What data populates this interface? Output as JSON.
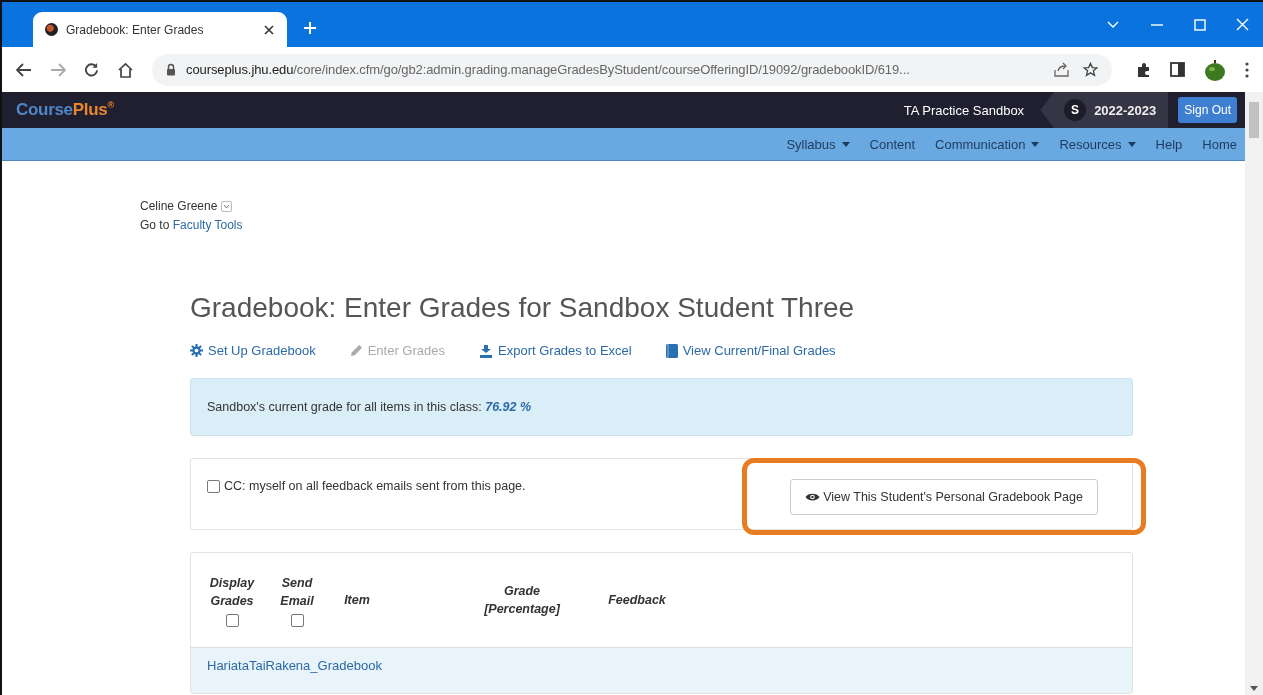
{
  "browser": {
    "tab_title": "Gradebook: Enter Grades",
    "url_host": "courseplus.jhu.edu",
    "url_path": "/core/index.cfm/go/gb2:admin.grading.manageGradesByStudent/courseOfferingID/19092/gradebookID/619..."
  },
  "header": {
    "logo_first": "Course",
    "logo_second": "Plus$^{®}$",
    "site": "TA Practice Sandbox",
    "avatar": "S",
    "term": "2022-2023",
    "sign_out": "Sign Out"
  },
  "nav": [
    {
      "label": "Syllabus",
      "dropdown": true
    },
    {
      "label": "Content",
      "dropdown": false
    },
    {
      "label": "Communication",
      "dropdown": true
    },
    {
      "label": "Resources",
      "dropdown": true
    },
    {
      "label": "Help",
      "dropdown": false
    },
    {
      "label": "Home",
      "dropdown": false
    }
  ],
  "user": {
    "name": "Celine Greene",
    "goto_prefix": "Go to",
    "goto_link": "Faculty Tools"
  },
  "title": "Gradebook: Enter Grades for Sandbox Student Three",
  "actions": [
    {
      "kind": "gear",
      "label": "Set Up Gradebook",
      "disabled": false
    },
    {
      "kind": "pencil",
      "label": "Enter Grades",
      "disabled": true
    },
    {
      "kind": "export",
      "label": "Export Grades to Excel",
      "disabled": false
    },
    {
      "kind": "book",
      "label": "View Current/Final Grades",
      "disabled": false
    }
  ],
  "grade_alert": {
    "text": "Sandbox's current grade for all items in this class:",
    "value": "76.92 %"
  },
  "cc": {
    "label": "CC: myself on all feedback emails sent from this page.",
    "checked": false
  },
  "view_button": {
    "label": "View This Student's Personal Gradebook Page",
    "highlighted": true
  },
  "table": {
    "columns": [
      {
        "kind": "check",
        "label": "Display Grades",
        "checked": false
      },
      {
        "kind": "check",
        "label": "Send Email",
        "checked": false
      },
      {
        "kind": "text",
        "label": "Item"
      },
      {
        "kind": "text",
        "label": "Grade [Percentage]"
      },
      {
        "kind": "text",
        "label": "Feedback"
      }
    ],
    "group": "HariataTaiRakena_Gradebook"
  }
}
